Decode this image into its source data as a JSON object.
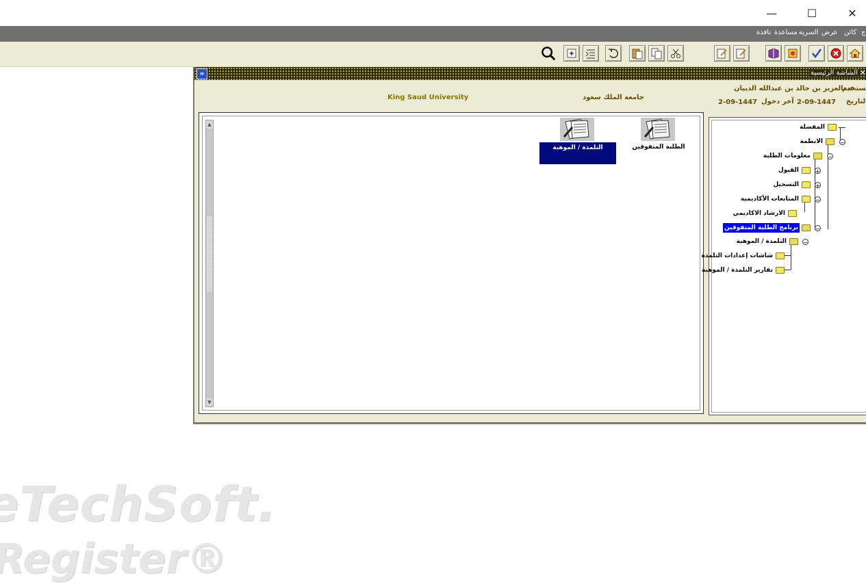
{
  "window_controls": {
    "minimize": "—",
    "maximize": "☐",
    "close": "✕"
  },
  "menubar": {
    "items": [
      "ج",
      "كائن",
      "عرض",
      "السرية",
      "مساعدة",
      "نافذة"
    ]
  },
  "toolbar": {
    "icons": [
      "home-icon",
      "cancel-icon",
      "check-icon",
      "bookmark-icon",
      "book-icon",
      "edit-icon",
      "edit-icon",
      "cut-icon",
      "copy-icon",
      "paste-icon",
      "undo-icon",
      "indent-icon",
      "insert-icon",
      "search-icon"
    ]
  },
  "window": {
    "title": "الشاشة الرئيسية",
    "close": "✕",
    "sys_icon": "≡"
  },
  "header": {
    "user_label": "المستخدم:",
    "user_name": "عبدالعزيز بن خالد بن عبدالله الدبيان",
    "date_label": "التاريخ :",
    "date_value": "2-09-1447",
    "last_login_label": "آخر دخول",
    "last_login_value": "2-09-1447",
    "university_ar": "جامعة الملك سعود",
    "university_en": "King Saud University"
  },
  "tiles": [
    {
      "label": "الطلبة المتفوقين"
    },
    {
      "label": "التلمذة / الموهبة"
    }
  ],
  "tree": {
    "nodes": [
      {
        "label": "المفضلة"
      },
      {
        "label": "الانظمة"
      },
      {
        "label": "معلومات الطلبة"
      },
      {
        "label": "القبول"
      },
      {
        "label": "التسجيل"
      },
      {
        "label": "المتابعات الأكاديمية"
      },
      {
        "label": "الارشاد الاكاديمي"
      },
      {
        "label": "برنامج الطلبة المتفوقين"
      },
      {
        "label": "التلمذة / الموهبة"
      },
      {
        "label": "شاشات إعدادات التلمذة"
      },
      {
        "label": "تقارير التلمذة / الموهبة"
      }
    ]
  },
  "watermark": {
    "line1": "eTechSoft.",
    "line2": "Register®"
  },
  "colors": {
    "menubar": "#707070",
    "toolbar": "#ecebd6",
    "selection": "#0000ee",
    "tile_selection": "#000a7a",
    "header_text": "#6a4e00"
  }
}
